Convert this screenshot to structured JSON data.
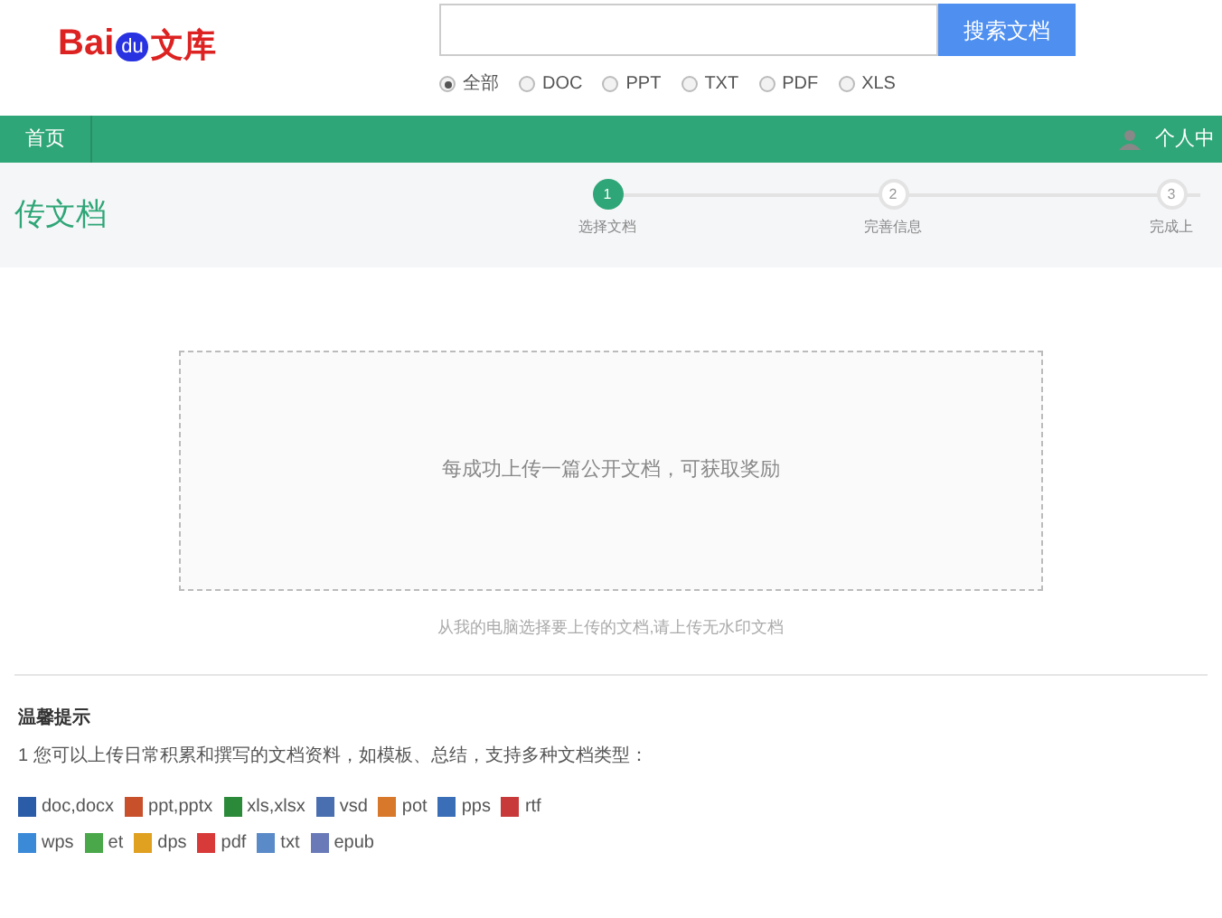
{
  "logo": {
    "brand": "Bai",
    "paw": "du",
    "product": "文库"
  },
  "search": {
    "button": "搜索文档"
  },
  "filters": [
    {
      "label": "全部",
      "selected": true
    },
    {
      "label": "DOC",
      "selected": false
    },
    {
      "label": "PPT",
      "selected": false
    },
    {
      "label": "TXT",
      "selected": false
    },
    {
      "label": "PDF",
      "selected": false
    },
    {
      "label": "XLS",
      "selected": false
    }
  ],
  "nav": {
    "home": "首页",
    "user": "个人中"
  },
  "page_title": "传文档",
  "steps": [
    {
      "number": "1",
      "label": "选择文档",
      "selected": true
    },
    {
      "number": "2",
      "label": "完善信息",
      "selected": false
    },
    {
      "number": "3",
      "label": "完成上",
      "selected": false
    }
  ],
  "dropzone": {
    "text": "每成功上传一篇公开文档，可获取奖励",
    "hint": "从我的电脑选择要上传的文档,请上传无水印文档"
  },
  "tips": {
    "title": "温馨提示",
    "line": "1 您可以上传日常积累和撰写的文档资料，如模板、总结，支持多种文档类型：",
    "types": [
      [
        {
          "label": "doc,docx",
          "color": "#2a5ca8"
        },
        {
          "label": "ppt,pptx",
          "color": "#c8502a"
        },
        {
          "label": "xls,xlsx",
          "color": "#2a8a3a"
        },
        {
          "label": "vsd",
          "color": "#4a6fb0"
        },
        {
          "label": "pot",
          "color": "#d8782a"
        },
        {
          "label": "pps",
          "color": "#3a6fb8"
        },
        {
          "label": "rtf",
          "color": "#c83a3a"
        }
      ],
      [
        {
          "label": "wps",
          "color": "#3a8ad8"
        },
        {
          "label": "et",
          "color": "#4aa84a"
        },
        {
          "label": "dps",
          "color": "#e0a020"
        },
        {
          "label": "pdf",
          "color": "#d83a3a"
        },
        {
          "label": "txt",
          "color": "#5a8ac8"
        },
        {
          "label": "epub",
          "color": "#6a7ab8"
        }
      ]
    ]
  }
}
